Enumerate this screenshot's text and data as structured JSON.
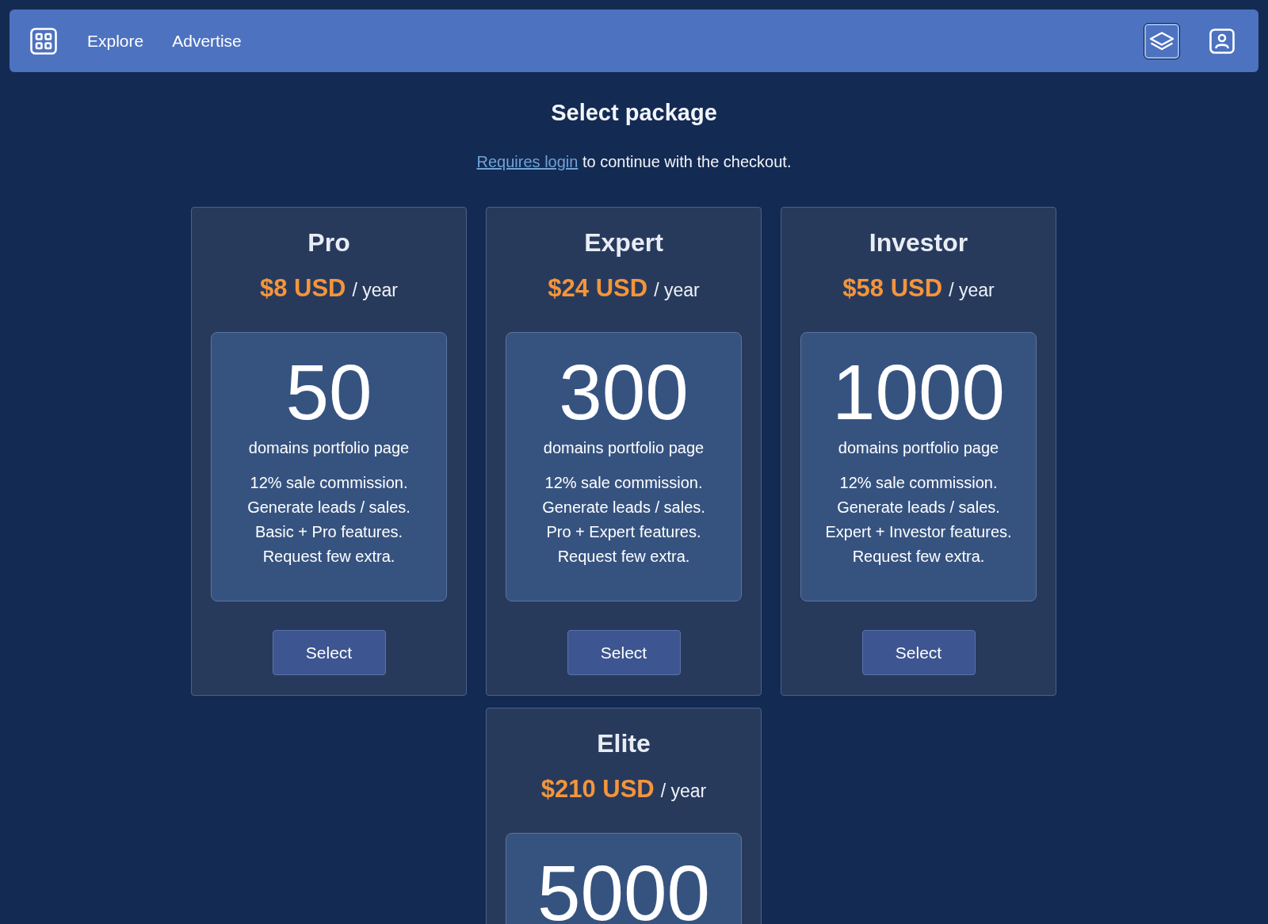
{
  "nav": {
    "links": [
      {
        "label": "Explore"
      },
      {
        "label": "Advertise"
      }
    ],
    "actions": [
      {
        "kind": "layers",
        "selected": true
      },
      {
        "kind": "profile",
        "selected": false
      }
    ]
  },
  "heading": "Select package",
  "notice": {
    "link": "Requires login",
    "text": "to continue with the checkout."
  },
  "packages": [
    {
      "name": "Pro",
      "price": "$8 USD",
      "period": "/ year",
      "count": "50",
      "count_label": "domains portfolio page",
      "features": [
        "12% sale commission.",
        "Generate leads / sales.",
        "Basic + Pro features.",
        "Request few extra."
      ],
      "button": "Select"
    },
    {
      "name": "Expert",
      "price": "$24 USD",
      "period": "/ year",
      "count": "300",
      "count_label": "domains portfolio page",
      "features": [
        "12% sale commission.",
        "Generate leads / sales.",
        "Pro + Expert features.",
        "Request few extra."
      ],
      "button": "Select"
    },
    {
      "name": "Investor",
      "price": "$58 USD",
      "period": "/ year",
      "count": "1000",
      "count_label": "domains portfolio page",
      "features": [
        "12% sale commission.",
        "Generate leads / sales.",
        "Expert + Investor features.",
        "Request few extra."
      ],
      "button": "Select"
    },
    {
      "name": "Elite",
      "price": "$210 USD",
      "period": "/ year",
      "count": "5000"
    }
  ]
}
